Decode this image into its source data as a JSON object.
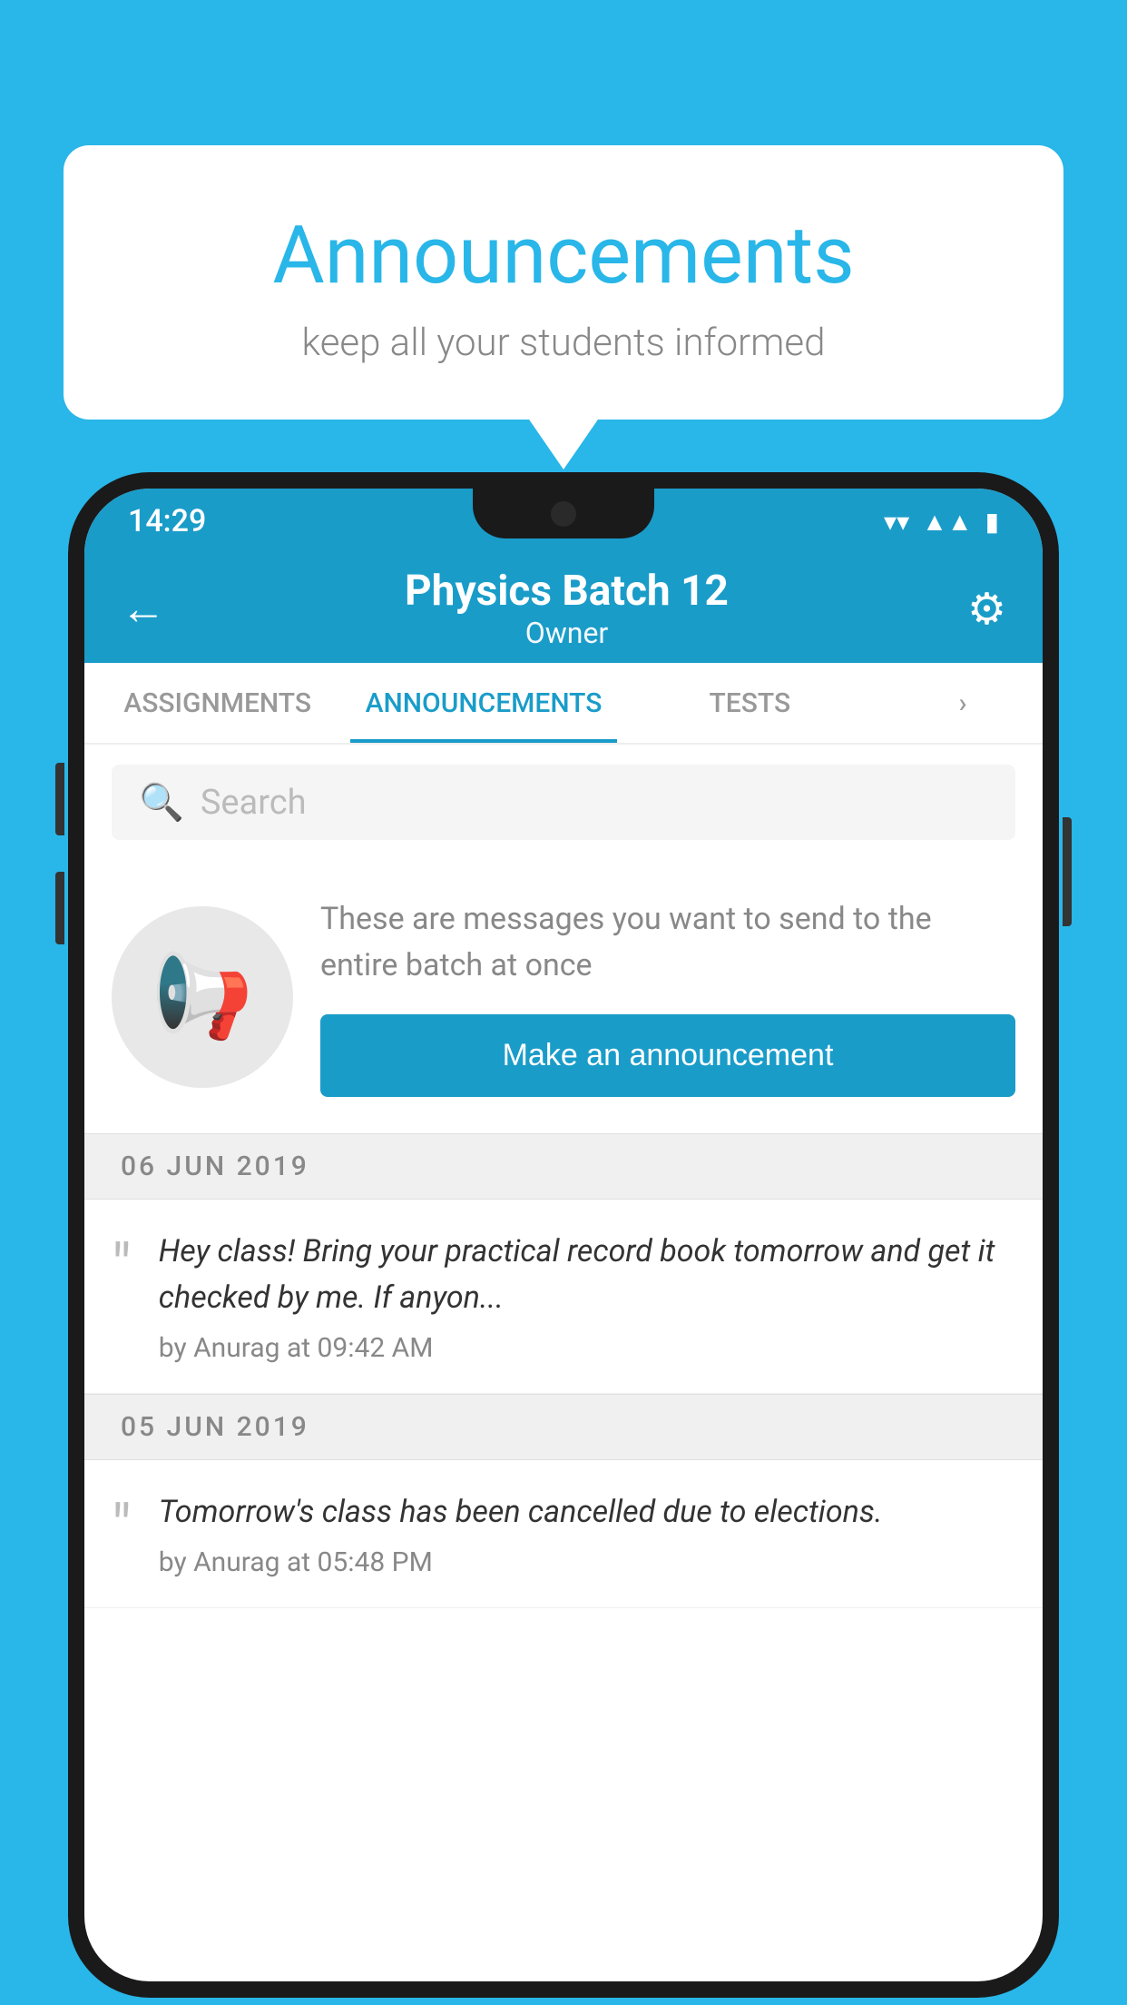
{
  "bubble": {
    "title": "Announcements",
    "subtitle": "keep all your students informed"
  },
  "phone": {
    "statusBar": {
      "time": "14:29",
      "icons": [
        "wifi",
        "signal",
        "battery"
      ]
    },
    "header": {
      "title": "Physics Batch 12",
      "subtitle": "Owner",
      "backLabel": "←",
      "settingsLabel": "⚙"
    },
    "tabs": [
      {
        "label": "ASSIGNMENTS",
        "active": false
      },
      {
        "label": "ANNOUNCEMENTS",
        "active": true
      },
      {
        "label": "TESTS",
        "active": false
      },
      {
        "label": "",
        "active": false,
        "partial": true
      }
    ],
    "search": {
      "placeholder": "Search"
    },
    "promoCard": {
      "text": "These are messages you want to send to the entire batch at once",
      "buttonLabel": "Make an announcement"
    },
    "announcements": [
      {
        "date": "06  JUN  2019",
        "items": [
          {
            "text": "Hey class! Bring your practical record book tomorrow and get it checked by me. If anyon...",
            "meta": "by Anurag at 09:42 AM"
          }
        ]
      },
      {
        "date": "05  JUN  2019",
        "items": [
          {
            "text": "Tomorrow's class has been cancelled due to elections.",
            "meta": "by Anurag at 05:48 PM"
          }
        ]
      }
    ]
  }
}
